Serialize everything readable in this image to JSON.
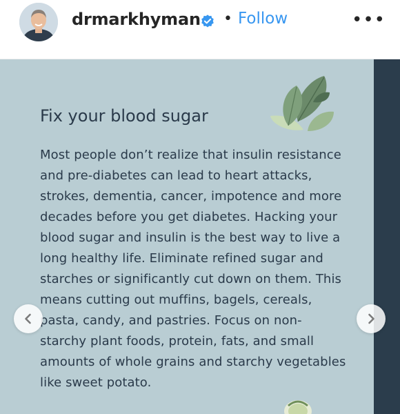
{
  "header": {
    "username": "drmarkhyman",
    "separator": "•",
    "follow_label": "Follow",
    "more_label": "•••",
    "verified_color": "#3897f0"
  },
  "post": {
    "title": "Fix your blood sugar",
    "body": "Most people don’t realize that insulin resistance and pre-diabetes can lead to heart attacks, strokes, dementia, cancer, impotence and more decades before you get diabetes. Hacking your blood sugar and insulin is the best way to live a long healthy life. Eliminate refined sugar and starches or significantly cut down on them. This means cutting out muffins, bagels, cereals, pasta, candy, and pastries. Focus on non-starchy plant foods, protein, fats, and small amounts of whole grains and starchy vegetables like sweet potato.",
    "background_color": "#b9cdd3",
    "text_color": "#2a3a4a"
  },
  "nav": {
    "prev_icon": "chevron-left-icon",
    "next_icon": "chevron-right-icon"
  }
}
